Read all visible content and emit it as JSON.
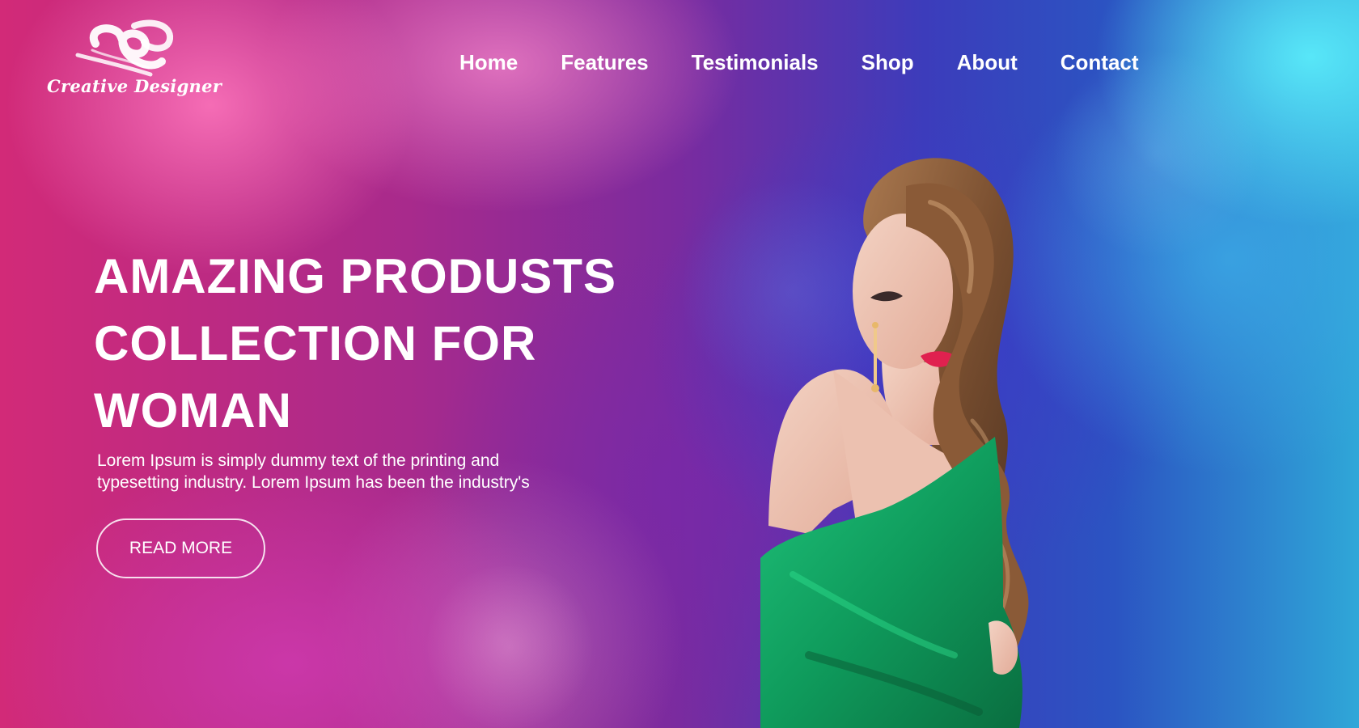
{
  "brand": {
    "logo_text": "Creative Designer",
    "logo_icon": "brush-swirl-icon"
  },
  "nav": {
    "items": [
      {
        "label": "Home"
      },
      {
        "label": "Features"
      },
      {
        "label": "Testimonials"
      },
      {
        "label": "Shop"
      },
      {
        "label": "About"
      },
      {
        "label": "Contact"
      }
    ]
  },
  "hero": {
    "title_line1": "AMAZING PRODUSTS",
    "title_line2": "COLLECTION FOR",
    "title_line3": "WOMAN",
    "description": "Lorem Ipsum is simply dummy text of the printing and typesetting industry. Lorem Ipsum has been the industry's",
    "button_label": "READ MORE"
  },
  "colors": {
    "accent_pink": "#d22a78",
    "accent_purple": "#7a2b9f",
    "accent_blue": "#2b54c2",
    "accent_cyan": "#5ae9fa",
    "dress_green": "#11a263",
    "text": "#ffffff"
  }
}
